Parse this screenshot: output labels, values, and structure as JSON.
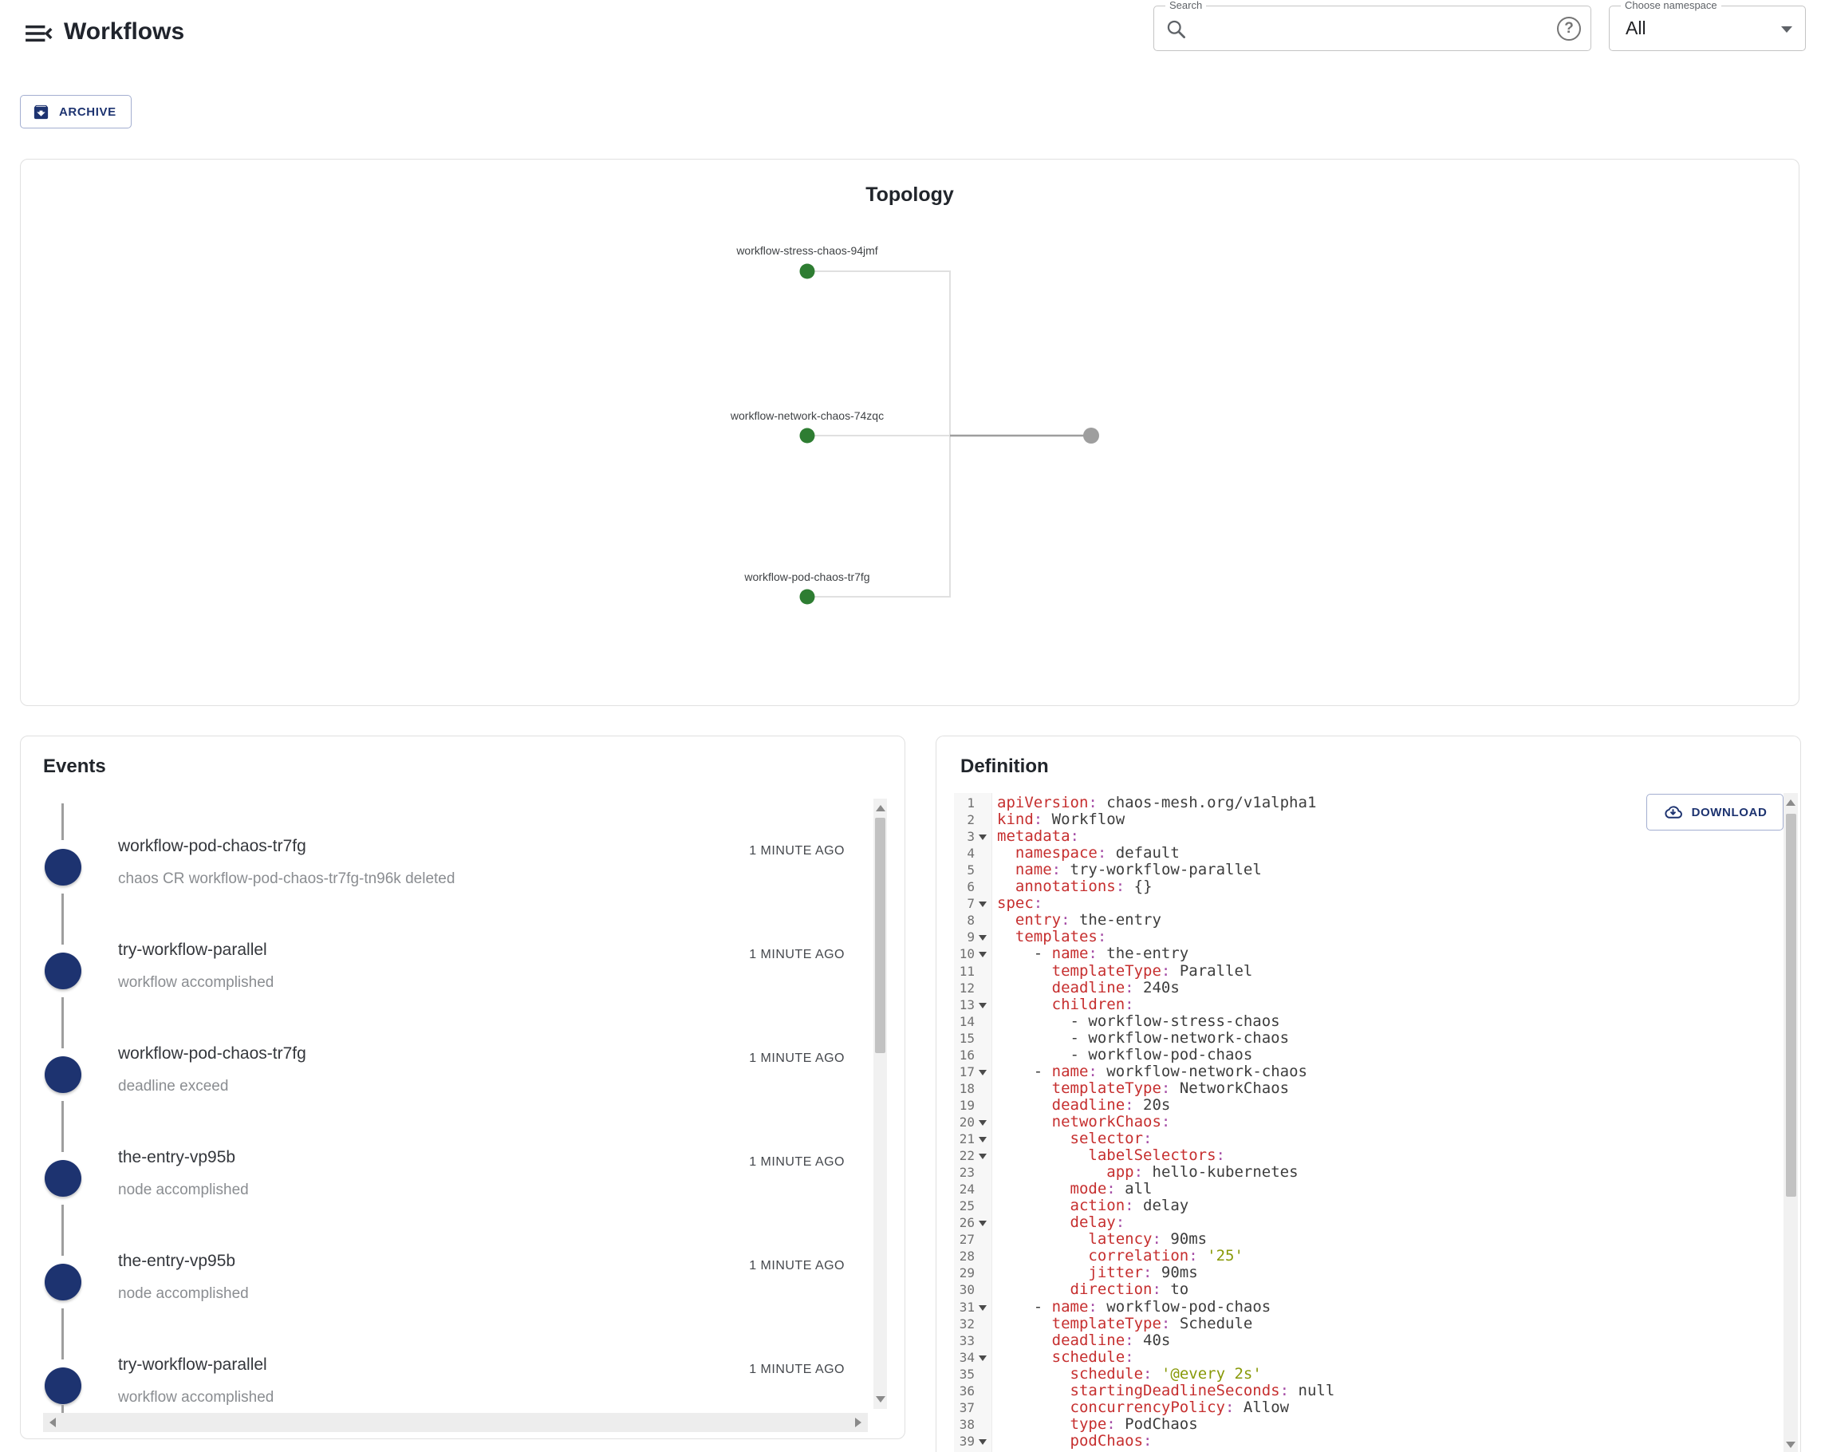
{
  "header": {
    "title": "Workflows",
    "search": {
      "label": "Search",
      "value": "",
      "placeholder": ""
    },
    "namespace": {
      "label": "Choose namespace",
      "value": "All"
    }
  },
  "toolbar": {
    "archive_label": "ARCHIVE"
  },
  "topology": {
    "title": "Topology",
    "nodes": [
      {
        "label": "workflow-stress-chaos-94jmf",
        "status": "succeed"
      },
      {
        "label": "workflow-network-chaos-74zqc",
        "status": "succeed"
      },
      {
        "label": "workflow-pod-chaos-tr7fg",
        "status": "succeed"
      }
    ],
    "end_node": {
      "status": "finished"
    },
    "colors": {
      "succeed": "#2e7d32",
      "end": "#9e9e9e",
      "link_light": "#e0e0e0",
      "link_dark": "#9e9e9e"
    }
  },
  "events": {
    "title": "Events",
    "items": [
      {
        "name": "workflow-pod-chaos-tr7fg",
        "message": "chaos CR workflow-pod-chaos-tr7fg-tn96k deleted",
        "time": "1 MINUTE AGO"
      },
      {
        "name": "try-workflow-parallel",
        "message": "workflow accomplished",
        "time": "1 MINUTE AGO"
      },
      {
        "name": "workflow-pod-chaos-tr7fg",
        "message": "deadline exceed",
        "time": "1 MINUTE AGO"
      },
      {
        "name": "the-entry-vp95b",
        "message": "node accomplished",
        "time": "1 MINUTE AGO"
      },
      {
        "name": "the-entry-vp95b",
        "message": "node accomplished",
        "time": "1 MINUTE AGO"
      },
      {
        "name": "try-workflow-parallel",
        "message": "workflow accomplished",
        "time": "1 MINUTE AGO"
      }
    ],
    "marker_color": "#1d3370"
  },
  "definition": {
    "title": "Definition",
    "download_label": "DOWNLOAD",
    "code_lines": [
      {
        "n": 1,
        "fold": false,
        "tokens": [
          [
            "k",
            "apiVersion"
          ],
          [
            "c",
            ":"
          ],
          [
            "v",
            " chaos-mesh.org/v1alpha1"
          ]
        ]
      },
      {
        "n": 2,
        "fold": false,
        "tokens": [
          [
            "k",
            "kind"
          ],
          [
            "c",
            ":"
          ],
          [
            "v",
            " Workflow"
          ]
        ]
      },
      {
        "n": 3,
        "fold": true,
        "tokens": [
          [
            "k",
            "metadata"
          ],
          [
            "c",
            ":"
          ]
        ]
      },
      {
        "n": 4,
        "fold": false,
        "tokens": [
          [
            "v",
            "  "
          ],
          [
            "k",
            "namespace"
          ],
          [
            "c",
            ":"
          ],
          [
            "v",
            " default"
          ]
        ]
      },
      {
        "n": 5,
        "fold": false,
        "tokens": [
          [
            "v",
            "  "
          ],
          [
            "k",
            "name"
          ],
          [
            "c",
            ":"
          ],
          [
            "v",
            " try-workflow-parallel"
          ]
        ]
      },
      {
        "n": 6,
        "fold": false,
        "tokens": [
          [
            "v",
            "  "
          ],
          [
            "k",
            "annotations"
          ],
          [
            "c",
            ":"
          ],
          [
            "v",
            " {}"
          ]
        ]
      },
      {
        "n": 7,
        "fold": true,
        "tokens": [
          [
            "k",
            "spec"
          ],
          [
            "c",
            ":"
          ]
        ]
      },
      {
        "n": 8,
        "fold": false,
        "tokens": [
          [
            "v",
            "  "
          ],
          [
            "k",
            "entry"
          ],
          [
            "c",
            ":"
          ],
          [
            "v",
            " the-entry"
          ]
        ]
      },
      {
        "n": 9,
        "fold": true,
        "tokens": [
          [
            "v",
            "  "
          ],
          [
            "k",
            "templates"
          ],
          [
            "c",
            ":"
          ]
        ]
      },
      {
        "n": 10,
        "fold": true,
        "tokens": [
          [
            "v",
            "    - "
          ],
          [
            "k",
            "name"
          ],
          [
            "c",
            ":"
          ],
          [
            "v",
            " the-entry"
          ]
        ]
      },
      {
        "n": 11,
        "fold": false,
        "tokens": [
          [
            "v",
            "      "
          ],
          [
            "k",
            "templateType"
          ],
          [
            "c",
            ":"
          ],
          [
            "v",
            " Parallel"
          ]
        ]
      },
      {
        "n": 12,
        "fold": false,
        "tokens": [
          [
            "v",
            "      "
          ],
          [
            "k",
            "deadline"
          ],
          [
            "c",
            ":"
          ],
          [
            "v",
            " 240s"
          ]
        ]
      },
      {
        "n": 13,
        "fold": true,
        "tokens": [
          [
            "v",
            "      "
          ],
          [
            "k",
            "children"
          ],
          [
            "c",
            ":"
          ]
        ]
      },
      {
        "n": 14,
        "fold": false,
        "tokens": [
          [
            "v",
            "        - workflow-stress-chaos"
          ]
        ]
      },
      {
        "n": 15,
        "fold": false,
        "tokens": [
          [
            "v",
            "        - workflow-network-chaos"
          ]
        ]
      },
      {
        "n": 16,
        "fold": false,
        "tokens": [
          [
            "v",
            "        - workflow-pod-chaos"
          ]
        ]
      },
      {
        "n": 17,
        "fold": true,
        "tokens": [
          [
            "v",
            "    - "
          ],
          [
            "k",
            "name"
          ],
          [
            "c",
            ":"
          ],
          [
            "v",
            " workflow-network-chaos"
          ]
        ]
      },
      {
        "n": 18,
        "fold": false,
        "tokens": [
          [
            "v",
            "      "
          ],
          [
            "k",
            "templateType"
          ],
          [
            "c",
            ":"
          ],
          [
            "v",
            " NetworkChaos"
          ]
        ]
      },
      {
        "n": 19,
        "fold": false,
        "tokens": [
          [
            "v",
            "      "
          ],
          [
            "k",
            "deadline"
          ],
          [
            "c",
            ":"
          ],
          [
            "v",
            " 20s"
          ]
        ]
      },
      {
        "n": 20,
        "fold": true,
        "tokens": [
          [
            "v",
            "      "
          ],
          [
            "k",
            "networkChaos"
          ],
          [
            "c",
            ":"
          ]
        ]
      },
      {
        "n": 21,
        "fold": true,
        "tokens": [
          [
            "v",
            "        "
          ],
          [
            "k",
            "selector"
          ],
          [
            "c",
            ":"
          ]
        ]
      },
      {
        "n": 22,
        "fold": true,
        "tokens": [
          [
            "v",
            "          "
          ],
          [
            "k",
            "labelSelectors"
          ],
          [
            "c",
            ":"
          ]
        ]
      },
      {
        "n": 23,
        "fold": false,
        "tokens": [
          [
            "v",
            "            "
          ],
          [
            "k",
            "app"
          ],
          [
            "c",
            ":"
          ],
          [
            "v",
            " hello-kubernetes"
          ]
        ]
      },
      {
        "n": 24,
        "fold": false,
        "tokens": [
          [
            "v",
            "        "
          ],
          [
            "k",
            "mode"
          ],
          [
            "c",
            ":"
          ],
          [
            "v",
            " all"
          ]
        ]
      },
      {
        "n": 25,
        "fold": false,
        "tokens": [
          [
            "v",
            "        "
          ],
          [
            "k",
            "action"
          ],
          [
            "c",
            ":"
          ],
          [
            "v",
            " delay"
          ]
        ]
      },
      {
        "n": 26,
        "fold": true,
        "tokens": [
          [
            "v",
            "        "
          ],
          [
            "k",
            "delay"
          ],
          [
            "c",
            ":"
          ]
        ]
      },
      {
        "n": 27,
        "fold": false,
        "tokens": [
          [
            "v",
            "          "
          ],
          [
            "k",
            "latency"
          ],
          [
            "c",
            ":"
          ],
          [
            "v",
            " 90ms"
          ]
        ]
      },
      {
        "n": 28,
        "fold": false,
        "tokens": [
          [
            "v",
            "          "
          ],
          [
            "k",
            "correlation"
          ],
          [
            "c",
            ":"
          ],
          [
            "v",
            " "
          ],
          [
            "s",
            "'25'"
          ]
        ]
      },
      {
        "n": 29,
        "fold": false,
        "tokens": [
          [
            "v",
            "          "
          ],
          [
            "k",
            "jitter"
          ],
          [
            "c",
            ":"
          ],
          [
            "v",
            " 90ms"
          ]
        ]
      },
      {
        "n": 30,
        "fold": false,
        "tokens": [
          [
            "v",
            "        "
          ],
          [
            "k",
            "direction"
          ],
          [
            "c",
            ":"
          ],
          [
            "v",
            " to"
          ]
        ]
      },
      {
        "n": 31,
        "fold": true,
        "tokens": [
          [
            "v",
            "    - "
          ],
          [
            "k",
            "name"
          ],
          [
            "c",
            ":"
          ],
          [
            "v",
            " workflow-pod-chaos"
          ]
        ]
      },
      {
        "n": 32,
        "fold": false,
        "tokens": [
          [
            "v",
            "      "
          ],
          [
            "k",
            "templateType"
          ],
          [
            "c",
            ":"
          ],
          [
            "v",
            " Schedule"
          ]
        ]
      },
      {
        "n": 33,
        "fold": false,
        "tokens": [
          [
            "v",
            "      "
          ],
          [
            "k",
            "deadline"
          ],
          [
            "c",
            ":"
          ],
          [
            "v",
            " 40s"
          ]
        ]
      },
      {
        "n": 34,
        "fold": true,
        "tokens": [
          [
            "v",
            "      "
          ],
          [
            "k",
            "schedule"
          ],
          [
            "c",
            ":"
          ]
        ]
      },
      {
        "n": 35,
        "fold": false,
        "tokens": [
          [
            "v",
            "        "
          ],
          [
            "k",
            "schedule"
          ],
          [
            "c",
            ":"
          ],
          [
            "v",
            " "
          ],
          [
            "s",
            "'@every 2s'"
          ]
        ]
      },
      {
        "n": 36,
        "fold": false,
        "tokens": [
          [
            "v",
            "        "
          ],
          [
            "k",
            "startingDeadlineSeconds"
          ],
          [
            "c",
            ":"
          ],
          [
            "v",
            " null"
          ]
        ]
      },
      {
        "n": 37,
        "fold": false,
        "tokens": [
          [
            "v",
            "        "
          ],
          [
            "k",
            "concurrencyPolicy"
          ],
          [
            "c",
            ":"
          ],
          [
            "v",
            " Allow"
          ]
        ]
      },
      {
        "n": 38,
        "fold": false,
        "tokens": [
          [
            "v",
            "        "
          ],
          [
            "k",
            "type"
          ],
          [
            "c",
            ":"
          ],
          [
            "v",
            " PodChaos"
          ]
        ]
      },
      {
        "n": 39,
        "fold": true,
        "tokens": [
          [
            "v",
            "        "
          ],
          [
            "k",
            "podChaos"
          ],
          [
            "c",
            ":"
          ]
        ]
      }
    ]
  }
}
